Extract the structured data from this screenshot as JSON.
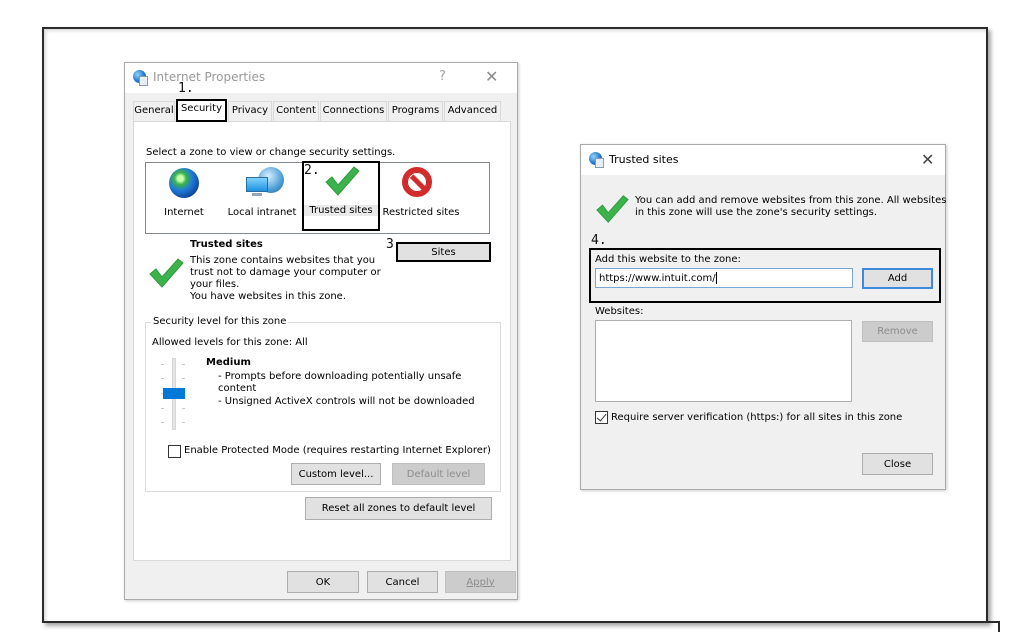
{
  "internet_properties": {
    "title": "Internet Properties",
    "help_label": "?",
    "close_label": "✕",
    "tabs": [
      {
        "label": "General",
        "active": false
      },
      {
        "label": "Security",
        "active": true
      },
      {
        "label": "Privacy",
        "active": false
      },
      {
        "label": "Content",
        "active": false
      },
      {
        "label": "Connections",
        "active": false
      },
      {
        "label": "Programs",
        "active": false
      },
      {
        "label": "Advanced",
        "active": false
      }
    ],
    "zone_prompt": "Select a zone to view or change security settings.",
    "zones": [
      {
        "label": "Internet",
        "icon": "globe-icon",
        "selected": false
      },
      {
        "label": "Local intranet",
        "icon": "local-intranet-icon",
        "selected": false
      },
      {
        "label": "Trusted sites",
        "icon": "green-check-icon",
        "selected": true
      },
      {
        "label": "Restricted sites",
        "icon": "no-entry-icon",
        "selected": false
      }
    ],
    "zone_description": {
      "title": "Trusted sites",
      "lines": [
        "This zone contains websites that you",
        "trust not to damage your computer or",
        "your files.",
        "You have websites in this zone."
      ]
    },
    "sites_button": "Sites",
    "security_level": {
      "group_title": "Security level for this zone",
      "allowed_levels": "Allowed levels for this zone: All",
      "level_name": "Medium",
      "slider_positions": 5,
      "slider_value_index": 2,
      "details": [
        "- Prompts before downloading potentially unsafe",
        "content",
        "- Unsigned ActiveX controls will not be downloaded"
      ],
      "protected_mode_label": "Enable Protected Mode (requires restarting Internet Explorer)",
      "protected_mode_checked": false,
      "custom_level_button": "Custom level...",
      "default_level_button": "Default level"
    },
    "reset_button": "Reset all zones to default level",
    "ok_button": "OK",
    "cancel_button": "Cancel",
    "apply_button": "Apply"
  },
  "trusted_sites": {
    "title": "Trusted sites",
    "close_label": "✕",
    "info_lines": [
      "You can add and remove websites from this zone. All websites",
      "in this zone will use the zone's security settings."
    ],
    "add_label": "Add this website to the zone:",
    "add_input_value": "https://www.intuit.com/",
    "add_button": "Add",
    "websites_label": "Websites:",
    "websites": [],
    "remove_button": "Remove",
    "require_verification_label": "Require server verification (https:) for all sites in this zone",
    "require_verification_checked": true,
    "close_button": "Close"
  },
  "annotations": {
    "step1": "1.",
    "step2": "2.",
    "step3": "3.",
    "step4": "4."
  },
  "colors": {
    "accent": "#0078d7",
    "check_green": "#3cb34a",
    "restricted_red": "#d42a2a",
    "annotation_border": "#000000"
  }
}
